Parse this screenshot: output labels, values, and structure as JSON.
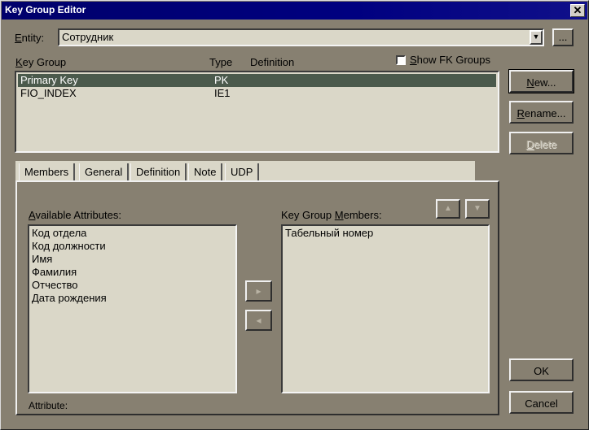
{
  "window": {
    "title": "Key Group Editor",
    "close_label": "✕"
  },
  "entity": {
    "label": "Entity:",
    "value": "Сотрудник",
    "browse_label": "..."
  },
  "keygroup": {
    "headers": {
      "name": "Key Group",
      "type": "Type",
      "definition": "Definition"
    },
    "show_fk_label": "Show FK Groups",
    "show_fk_checked": false,
    "rows": [
      {
        "name": "Primary Key",
        "type": "PK",
        "definition": "",
        "selected": true
      },
      {
        "name": "FIO_INDEX",
        "type": "IE1",
        "definition": "",
        "selected": false
      }
    ]
  },
  "buttons": {
    "new": "New...",
    "rename": "Rename...",
    "delete": "Delete",
    "ok": "OK",
    "cancel": "Cancel"
  },
  "tabs": [
    "Members",
    "General",
    "Definition",
    "Note",
    "UDP"
  ],
  "members": {
    "available_label": "Available Attributes:",
    "available": [
      "Код отдела",
      "Код должности",
      "Имя",
      "Фамилия",
      "Отчество",
      "Дата рождения"
    ],
    "members_label": "Key Group Members:",
    "members": [
      "Табельный номер"
    ],
    "move_right_icon": "▸",
    "move_left_icon": "◂",
    "move_up_icon": "▲",
    "move_down_icon": "▼",
    "attribute_label": "Attribute:"
  }
}
